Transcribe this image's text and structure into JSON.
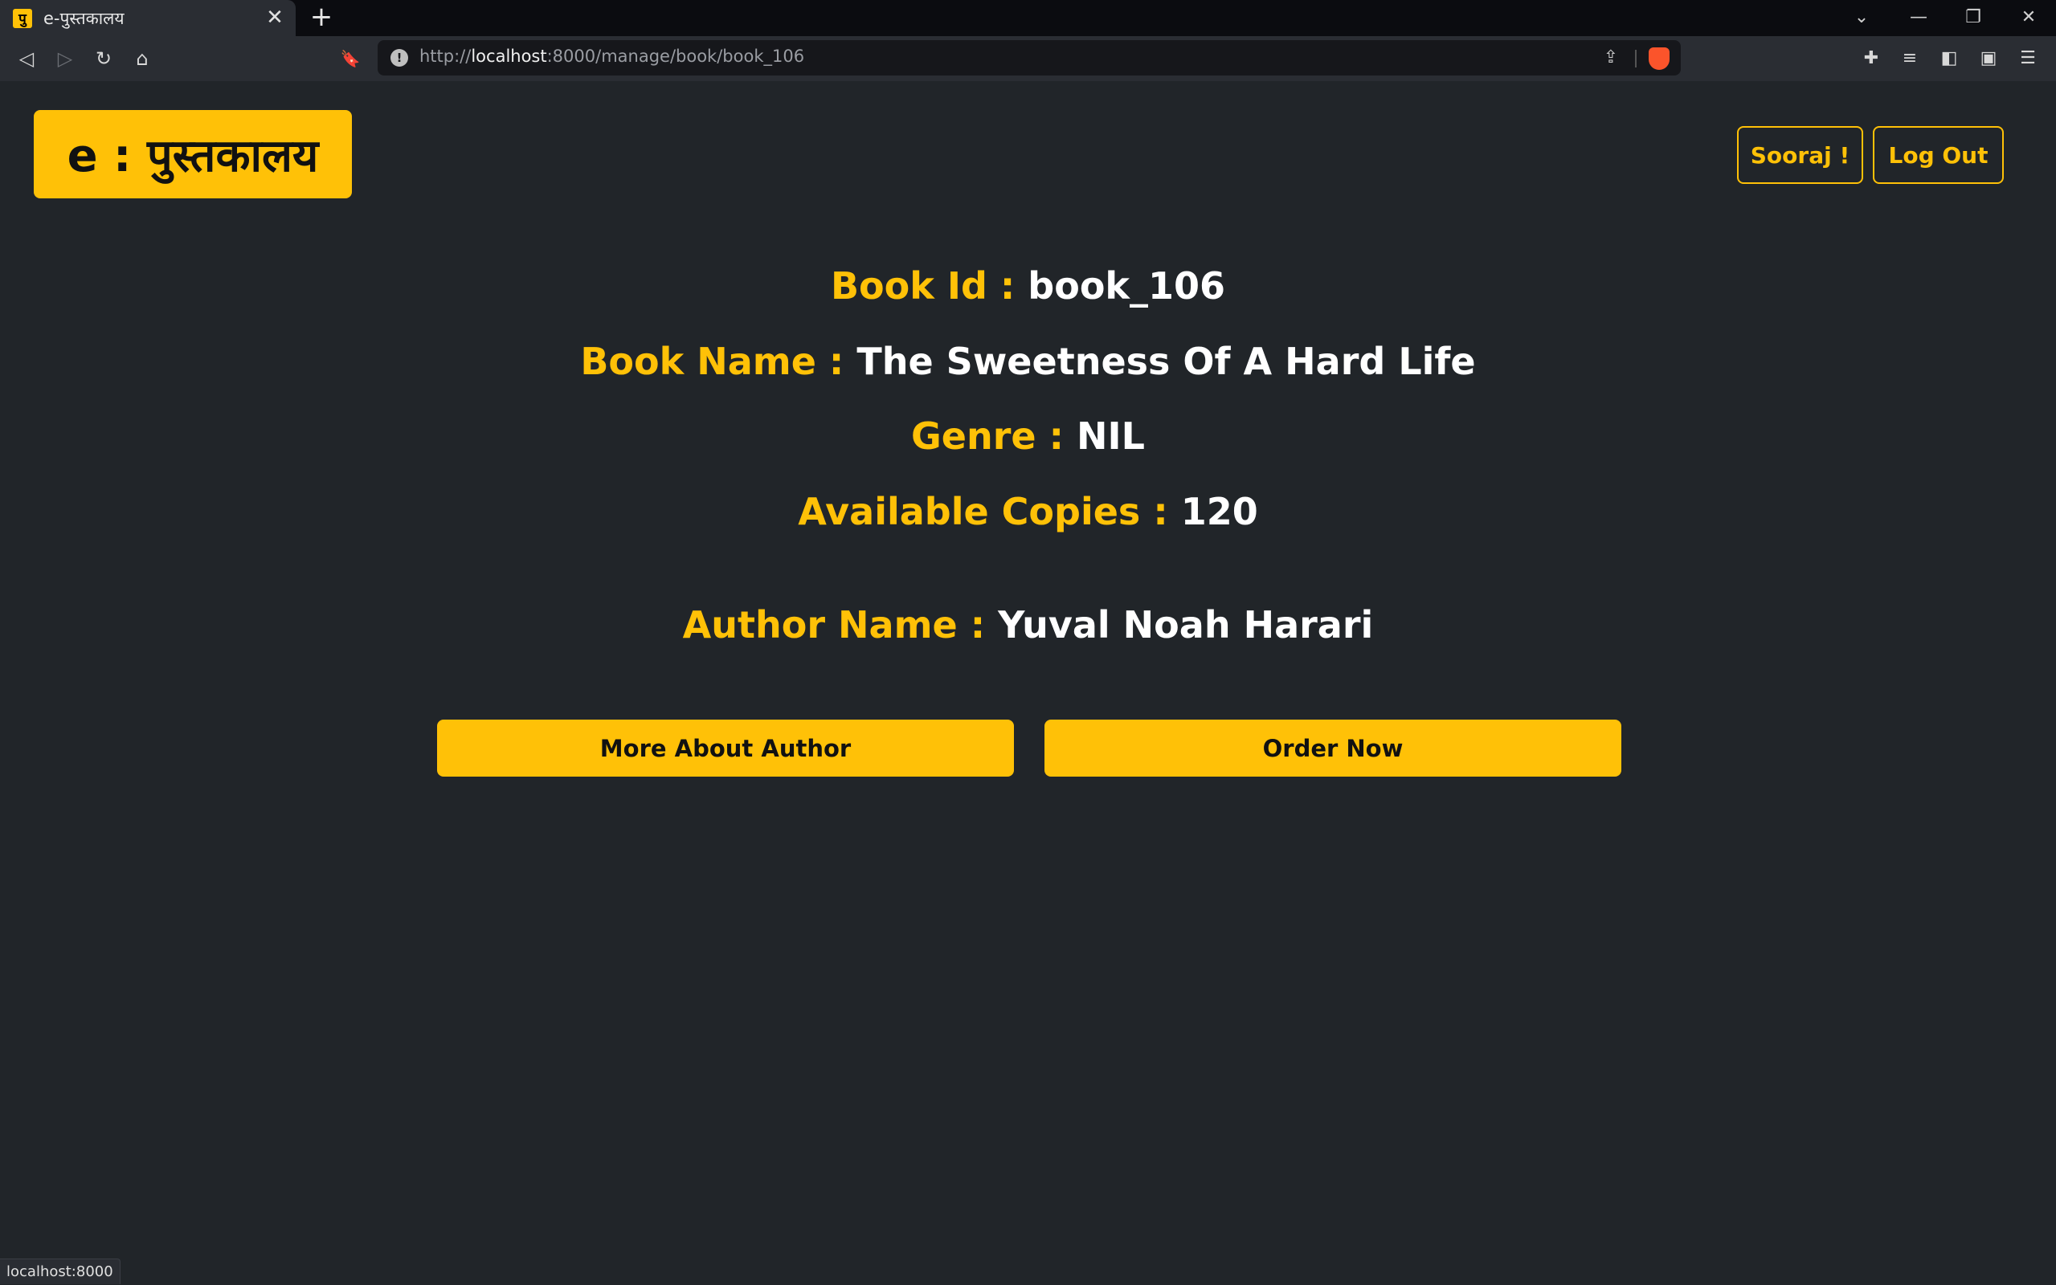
{
  "browser": {
    "tab": {
      "favicon": "पु",
      "title": "e-पुस्तकालय",
      "close": "✕"
    },
    "new_tab": "+",
    "window_controls": {
      "tab_search": "⌄",
      "minimize": "—",
      "restore": "❐",
      "close": "✕"
    },
    "nav": {
      "back": "◁",
      "forward": "▷",
      "reload": "↻",
      "home": "⌂",
      "bookmark": "🔖"
    },
    "url": {
      "scheme": "http://",
      "host": "localhost",
      "rest": ":8000/manage/book/book_106",
      "info": "!",
      "share": "⇪"
    },
    "extensions": {
      "puzzle": "✚",
      "playlist": "≡",
      "sidebar": "◧",
      "wallet": "▣",
      "menu": "☰"
    },
    "status_text": "localhost:8000"
  },
  "header": {
    "brand": "e : पुस्तकालय",
    "user_button": "Sooraj !",
    "logout_button": "Log Out"
  },
  "book": {
    "id_label": "Book Id :",
    "id_value": "book_106",
    "name_label": "Book Name :",
    "name_value": "The Sweetness Of A Hard Life",
    "genre_label": "Genre :",
    "genre_value": "NIL",
    "copies_label": "Available Copies :",
    "copies_value": "120",
    "author_label": "Author Name :",
    "author_value": "Yuval Noah Harari"
  },
  "actions": {
    "more_about_author": "More About Author",
    "order_now": "Order Now"
  },
  "colors": {
    "background": "#212529",
    "accent": "#ffc107",
    "text": "#ffffff"
  }
}
